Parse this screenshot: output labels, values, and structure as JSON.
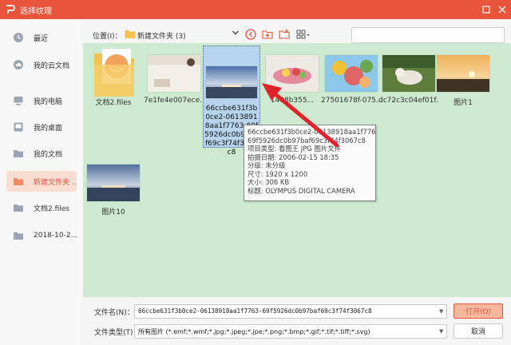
{
  "window": {
    "title": "选择纹理",
    "accent_color": "#e8553a",
    "controls": [
      "maximize-icon",
      "close-icon"
    ]
  },
  "sidebar": {
    "items": [
      {
        "label": "最近",
        "icon": "clock-icon",
        "active": false
      },
      {
        "label": "我的云文档",
        "icon": "cloud-icon",
        "active": false
      },
      {
        "label": "我的电脑",
        "icon": "computer-icon",
        "active": false
      },
      {
        "label": "我的桌面",
        "icon": "desktop-icon",
        "active": false
      },
      {
        "label": "我的文档",
        "icon": "folder-icon",
        "active": false
      },
      {
        "label": "新建文件夹 ...",
        "icon": "folder-icon",
        "active": true
      },
      {
        "label": "文档2.files",
        "icon": "folder-icon",
        "active": false
      },
      {
        "label": "2018-10-2...",
        "icon": "folder-icon",
        "active": false
      }
    ]
  },
  "location": {
    "label": "位置(I)：",
    "path": "新建文件夹 (3)",
    "tools": [
      "back-icon",
      "up-folder-icon",
      "new-folder-icon",
      "view-mode-icon"
    ],
    "search_placeholder": ""
  },
  "files": [
    {
      "name": "文档2.files",
      "kind": "folder"
    },
    {
      "name": "7e1fe4e007ece...",
      "kind": "image"
    },
    {
      "name": "66ccbe631f3b0ce2-06138918aa1f7763-69f5926dc0b97baf69c3f7f4f3067c8",
      "kind": "image",
      "selected": true
    },
    {
      "name": "1408b355...",
      "kind": "image"
    },
    {
      "name": "27501678f-075...",
      "kind": "image"
    },
    {
      "name": "dc72c3c04ef01f...",
      "kind": "image"
    },
    {
      "name": "图片1",
      "kind": "image"
    },
    {
      "name": "图片10",
      "kind": "image"
    }
  ],
  "selected_tile_text": "66ccbe631f3b0ce2-06138918aa1f7763-69f5926dc0b97baf69c3f74f3067c8",
  "tooltip": {
    "lines": [
      "66ccbe631f3b0ce2-06138918aa1f7763-",
      "69f5926dc0b97baf69c3f74f3067c8",
      "项目类型: 看图王 JPG 图片文件",
      "拍摄日期: 2006-02-15 18:35",
      "分级: 未分级",
      "尺寸: 1920 x 1200",
      "大小: 306 KB",
      "标题: OLYMPUS DIGITAL CAMERA"
    ]
  },
  "bottom": {
    "filename_label": "文件名(N)：",
    "filename_value": "66ccbe631f3b0ce2-06138918aa1f7763-69f5926dc0b97baf69c3f74f3067c8",
    "filetype_label": "文件类型(T)：",
    "filetype_value": "所有图片 (*.emf;*.wmf;*.jpg;*.jpeg;*.jpe;*.png;*.bmp;*.gif;*.tif;*.tiff;*.svg)",
    "open_label": "打开(O)",
    "cancel_label": "取消"
  }
}
